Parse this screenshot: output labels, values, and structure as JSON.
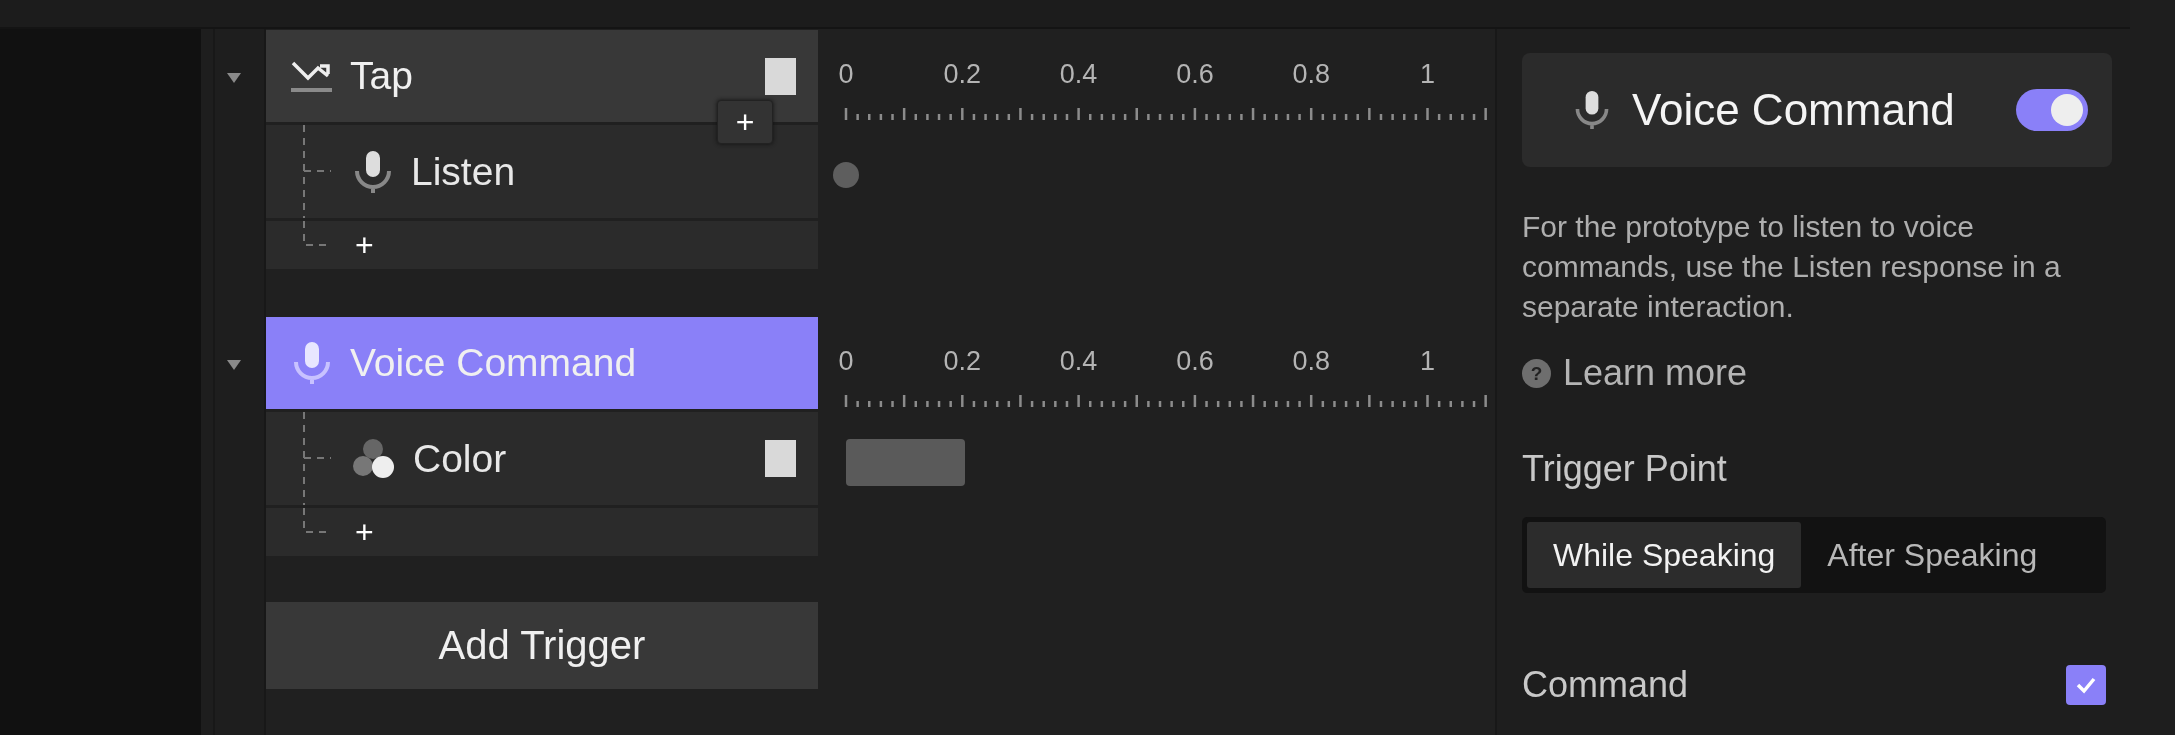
{
  "triggers": [
    {
      "name": "Tap",
      "kind": "tap",
      "selected": false,
      "expanded": true,
      "swatch": true,
      "add_label": "+",
      "floating_add": "+",
      "ruler": [
        "0",
        "0.2",
        "0.4",
        "0.6",
        "0.8",
        "1"
      ],
      "responses": [
        {
          "name": "Listen",
          "kind": "listen"
        }
      ]
    },
    {
      "name": "Voice Command",
      "kind": "voice",
      "selected": true,
      "expanded": true,
      "add_label": "+",
      "ruler": [
        "0",
        "0.2",
        "0.4",
        "0.6",
        "0.8",
        "1"
      ],
      "responses": [
        {
          "name": "Color",
          "kind": "color",
          "swatch": true
        }
      ]
    }
  ],
  "add_trigger": "Add Trigger",
  "inspector": {
    "title": "Voice Command",
    "on": true,
    "description": "For the prototype to listen to voice commands, use the Listen response in a separate interaction.",
    "help_icon": "?",
    "learn_more": "Learn more",
    "section": "Trigger Point",
    "options": [
      {
        "label": "While Speaking",
        "selected": true
      },
      {
        "label": "After Speaking",
        "selected": false
      }
    ],
    "command": {
      "label": "Command",
      "checked": true
    }
  }
}
